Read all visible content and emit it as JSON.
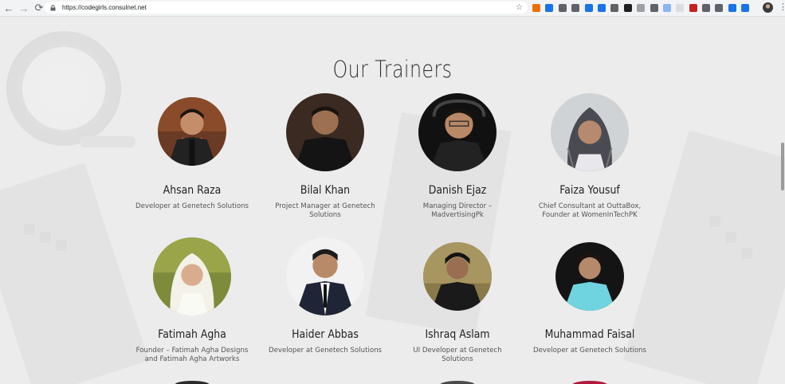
{
  "browser": {
    "url": "https://codegirls.consulnet.net",
    "back_icon": "←",
    "forward_icon": "→",
    "reload_icon": "⟳",
    "star_icon": "☆",
    "menu_icon": "⋮",
    "extension_colors": [
      "#e8710a",
      "#1a73e8",
      "#5f6368",
      "#5f6368",
      "#1a73e8",
      "#1a73e8",
      "#5f6368",
      "#202124",
      "#9aa0a6",
      "#5f6368",
      "#8ab4f8",
      "#dadce0",
      "#c5221f",
      "#5f6368",
      "#5f6368",
      "#1a73e8",
      "#1a73e8"
    ]
  },
  "section": {
    "title": "Our Trainers"
  },
  "trainers": [
    {
      "name": "Ahsan Raza",
      "role": "Developer at Genetech Solutions"
    },
    {
      "name": "Bilal Khan",
      "role": "Project Manager at Genetech Solutions"
    },
    {
      "name": "Danish Ejaz",
      "role": "Managing Director – MadvertisingPk"
    },
    {
      "name": "Faiza Yousuf",
      "role": "Chief Consultant at OuttaBox, Founder at WomenInTechPK"
    },
    {
      "name": "Fatimah Agha",
      "role": "Founder – Fatimah Agha Designs and Fatimah Agha Artworks"
    },
    {
      "name": "Haider Abbas",
      "role": "Developer at Genetech Solutions"
    },
    {
      "name": "Ishraq Aslam",
      "role": "UI Developer at Genetech Solutions"
    },
    {
      "name": "Muhammad Faisal",
      "role": "Developer at Genetech Solutions"
    }
  ]
}
